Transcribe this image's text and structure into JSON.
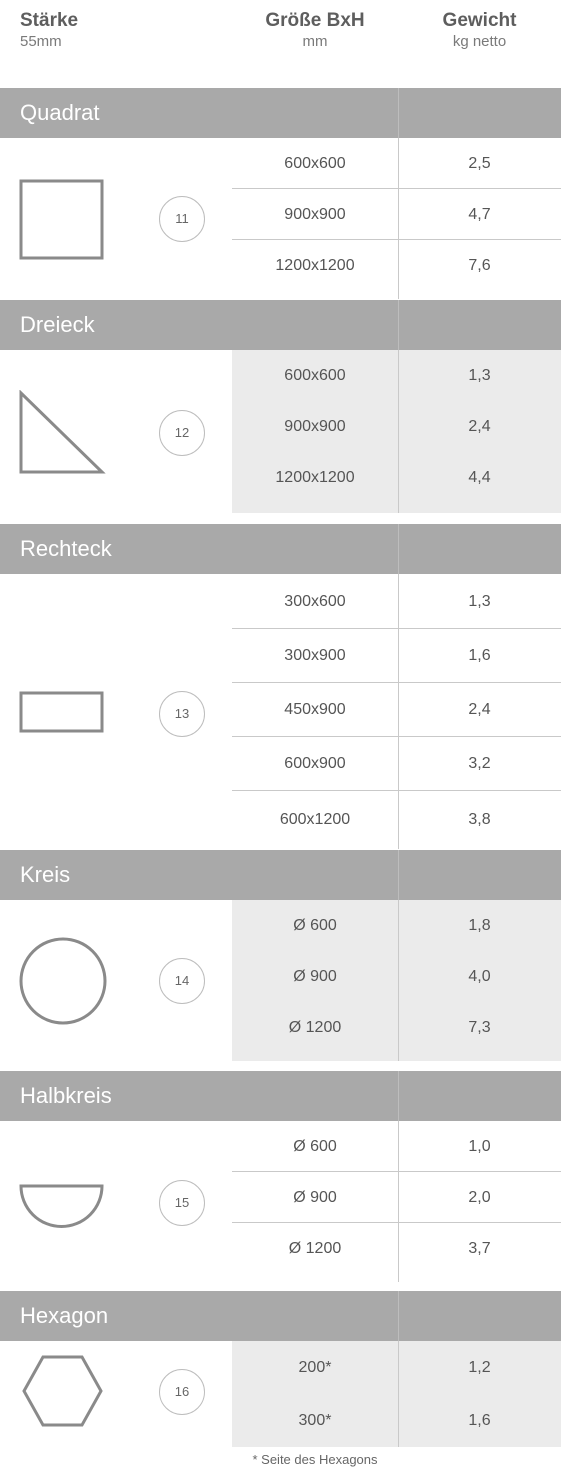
{
  "header": {
    "strength_title": "Stärke",
    "strength_sub": "55mm",
    "size_title": "Größe BxH",
    "size_sub": "mm",
    "weight_title": "Gewicht",
    "weight_sub": "kg netto"
  },
  "sections": [
    {
      "title": "Quadrat",
      "number": "11",
      "shape_icon": "square-icon",
      "rows": [
        {
          "size": "600x600",
          "weight": "2,5"
        },
        {
          "size": "900x900",
          "weight": "4,7"
        },
        {
          "size": "1200x1200",
          "weight": "7,6"
        }
      ]
    },
    {
      "title": "Dreieck",
      "number": "12",
      "shape_icon": "triangle-icon",
      "rows": [
        {
          "size": "600x600",
          "weight": "1,3"
        },
        {
          "size": "900x900",
          "weight": "2,4"
        },
        {
          "size": "1200x1200",
          "weight": "4,4"
        }
      ]
    },
    {
      "title": "Rechteck",
      "number": "13",
      "shape_icon": "rectangle-icon",
      "rows": [
        {
          "size": "300x600",
          "weight": "1,3"
        },
        {
          "size": "300x900",
          "weight": "1,6"
        },
        {
          "size": "450x900",
          "weight": "2,4"
        },
        {
          "size": "600x900",
          "weight": "3,2"
        },
        {
          "size": "600x1200",
          "weight": "3,8"
        }
      ]
    },
    {
      "title": "Kreis",
      "number": "14",
      "shape_icon": "circle-icon",
      "rows": [
        {
          "size": "Ø 600",
          "weight": "1,8"
        },
        {
          "size": "Ø 900",
          "weight": "4,0"
        },
        {
          "size": "Ø 1200",
          "weight": "7,3"
        }
      ]
    },
    {
      "title": "Halbkreis",
      "number": "15",
      "shape_icon": "semicircle-icon",
      "rows": [
        {
          "size": "Ø 600",
          "weight": "1,0"
        },
        {
          "size": "Ø 900",
          "weight": "2,0"
        },
        {
          "size": "Ø 1200",
          "weight": "3,7"
        }
      ]
    },
    {
      "title": "Hexagon",
      "number": "16",
      "shape_icon": "hexagon-icon",
      "rows": [
        {
          "size": "200*",
          "weight": "1,2"
        },
        {
          "size": "300*",
          "weight": "1,6"
        }
      ]
    }
  ],
  "footnote": "* Seite des Hexagons",
  "colors": {
    "section_header_bg": "#a9a9a9",
    "shaded_rows_bg": "#ebebeb",
    "shape_stroke": "#8a8a8a"
  }
}
